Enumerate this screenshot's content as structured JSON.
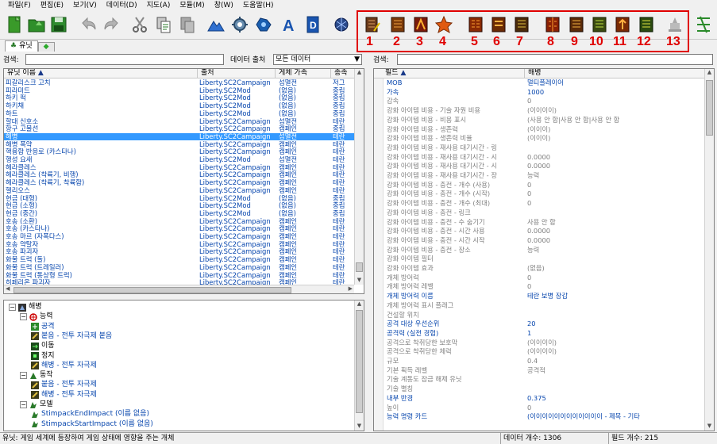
{
  "menu": [
    "파일(F)",
    "편집(E)",
    "보기(V)",
    "데이터(D)",
    "지도(A)",
    "모듈(M)",
    "창(W)",
    "도움말(H)"
  ],
  "toolbar": {
    "numbers": [
      "1",
      "2",
      "3",
      "4",
      "5",
      "6",
      "7",
      "8",
      "9",
      "10",
      "11",
      "12",
      "13"
    ]
  },
  "tabs": [
    "유닛",
    ""
  ],
  "left": {
    "search_label": "검색:",
    "search_value": "",
    "source_label": "데이터 출처",
    "source_value": "모든 데이터",
    "columns": [
      "유닛 이름",
      "출처",
      "게체 가족",
      "종족"
    ],
    "rows": [
      [
        "피갈리스크 고치",
        "Liberty.SC2Campaign",
        "섬멸전",
        "저그"
      ],
      [
        "피라미드",
        "Liberty.SC2Mod",
        "(없음)",
        "중립"
      ],
      [
        "하키 퍽",
        "Liberty.SC2Mod",
        "(없음)",
        "중립"
      ],
      [
        "하키채",
        "Liberty.SC2Mod",
        "(없음)",
        "중립"
      ],
      [
        "하트",
        "Liberty.SC2Mod",
        "(없음)",
        "중립"
      ],
      [
        "할대 신호소",
        "Liberty.SC2Campaign",
        "섬멸전",
        "테란"
      ],
      [
        "항구 고물선",
        "Liberty.SC2Campaign",
        "캠페인",
        "중립"
      ],
      [
        "해병",
        "Liberty.SC2Campaign",
        "섬멸전",
        "테란"
      ],
      [
        "해병 폭약",
        "Liberty.SC2Campaign",
        "캠페인",
        "테란"
      ],
      [
        "핵융합 반응로 (카스타나)",
        "Liberty.SC2Campaign",
        "캠페인",
        "테란"
      ],
      [
        "행성 요새",
        "Liberty.SC2Mod",
        "섬멸전",
        "테란"
      ],
      [
        "헤라클레스",
        "Liberty.SC2Campaign",
        "캠페인",
        "테란"
      ],
      [
        "헤라클레스 (착륙기, 비행)",
        "Liberty.SC2Campaign",
        "캠페인",
        "테란"
      ],
      [
        "헤라클레스 (착륙기, 착륙함)",
        "Liberty.SC2Campaign",
        "캠페인",
        "테란"
      ],
      [
        "헬리오스",
        "Liberty.SC2Campaign",
        "캠페인",
        "테란"
      ],
      [
        "현금 (대형)",
        "Liberty.SC2Mod",
        "(없음)",
        "중립"
      ],
      [
        "현금 (소형)",
        "Liberty.SC2Mod",
        "(없음)",
        "중립"
      ],
      [
        "현금 (중간)",
        "Liberty.SC2Mod",
        "(없음)",
        "중립"
      ],
      [
        "호송 (소환)",
        "Liberty.SC2Campaign",
        "캠페인",
        "테란"
      ],
      [
        "호송 (카스타나)",
        "Liberty.SC2Campaign",
        "캠페인",
        "테란"
      ],
      [
        "호송 마르 (자폭다스)",
        "Liberty.SC2Campaign",
        "캠페인",
        "테란"
      ],
      [
        "호송 약탈자",
        "Liberty.SC2Campaign",
        "캠페인",
        "테란"
      ],
      [
        "호송 파괴자",
        "Liberty.SC2Campaign",
        "캠페인",
        "테란"
      ],
      [
        "화물 트럭 (돌)",
        "Liberty.SC2Campaign",
        "캠페인",
        "테란"
      ],
      [
        "화물 트럭 (트레일러)",
        "Liberty.SC2Campaign",
        "캠페인",
        "테란"
      ],
      [
        "화물 트럭 (통상형 트럭)",
        "Liberty.SC2Campaign",
        "캠페인",
        "테란"
      ],
      [
        "히페리온 파괴자",
        "Liberty.SC2Campaign",
        "캠페인",
        "테란"
      ]
    ],
    "selected_index": 7
  },
  "tree": [
    {
      "indent": 0,
      "label": "해병",
      "icon": "marine-icon",
      "blue": false,
      "expand": "−"
    },
    {
      "indent": 1,
      "label": "능력",
      "icon": "ability-icon",
      "blue": false,
      "expand": "−"
    },
    {
      "indent": 2,
      "label": "공격",
      "icon": "attack-icon",
      "blue": true,
      "expand": ""
    },
    {
      "indent": 2,
      "label": "붙음 - 전투 자극제 붙음",
      "icon": "stim-icon",
      "blue": true,
      "expand": ""
    },
    {
      "indent": 2,
      "label": "이동",
      "icon": "move-icon",
      "blue": false,
      "expand": ""
    },
    {
      "indent": 2,
      "label": "정지",
      "icon": "stop-icon",
      "blue": false,
      "expand": ""
    },
    {
      "indent": 2,
      "label": "해병 - 전투 자극제",
      "icon": "stim-icon",
      "blue": true,
      "expand": ""
    },
    {
      "indent": 1,
      "label": "동작",
      "icon": "behavior-icon",
      "blue": false,
      "expand": "−"
    },
    {
      "indent": 2,
      "label": "붙음 - 전투 자극제",
      "icon": "stim-icon",
      "blue": true,
      "expand": ""
    },
    {
      "indent": 2,
      "label": "해병 - 전투 자극제",
      "icon": "stim-icon",
      "blue": true,
      "expand": ""
    },
    {
      "indent": 1,
      "label": "모델",
      "icon": "model-icon",
      "blue": false,
      "expand": "−"
    },
    {
      "indent": 2,
      "label": "StimpackEndImpact (이름 없음)",
      "icon": "model-icon",
      "blue": true,
      "expand": ""
    },
    {
      "indent": 2,
      "label": "StimpackStartImpact (이름 없음)",
      "icon": "model-icon",
      "blue": true,
      "expand": ""
    }
  ],
  "right": {
    "search_label": "검색:",
    "columns": [
      "필드",
      "해병"
    ],
    "rows": [
      [
        "MOB",
        "멀티플레이어",
        true
      ],
      [
        "가속",
        "1000",
        true
      ],
      [
        "감속",
        "0",
        false
      ],
      [
        "강화 아이템 비용 - 기술 자원 비용",
        "(이이이이)",
        false
      ],
      [
        "강화 아이템 비용 - 비용 표시",
        "(사용 안 함|사용 안 함|사용 안 함",
        false
      ],
      [
        "강화 아이템 비용 - 생존력",
        "(이이이)",
        false
      ],
      [
        "강화 아이템 비용 - 생존력 비율",
        "(이이이)",
        false
      ],
      [
        "강화 아이템 비용 - 재사용 대기시간 - 링",
        "",
        false
      ],
      [
        "강화 아이템 비용 - 재사용 대기시간 - 시",
        "0.0000",
        false
      ],
      [
        "강화 아이템 비용 - 재사용 대기시간 - 시",
        "0.0000",
        false
      ],
      [
        "강화 아이템 비용 - 재사용 대기시간 - 장",
        "능력",
        false
      ],
      [
        "강화 아이템 비용 - 충전 - 개수 (사용)",
        "0",
        false
      ],
      [
        "강화 아이템 비용 - 충전 - 개수 (시작)",
        "0",
        false
      ],
      [
        "강화 아이템 비용 - 충전 - 개수 (최대)",
        "0",
        false
      ],
      [
        "강화 아이템 비용 - 충전 - 링크",
        "",
        false
      ],
      [
        "강화 아이템 비용 - 충전 - 수 숨기기",
        "사용 안 함",
        false
      ],
      [
        "강화 아이템 비용 - 충전 - 시간 사용",
        "0.0000",
        false
      ],
      [
        "강화 아이템 비용 - 충전 - 시간 시작",
        "0.0000",
        false
      ],
      [
        "강화 아이템 비용 - 충전 - 장소",
        "능력",
        false
      ],
      [
        "강화 아이템 필터",
        "",
        false
      ],
      [
        "강화 아이템 효과",
        "(없음)",
        false
      ],
      [
        "개체 방어력",
        "0",
        false
      ],
      [
        "개체 방어력 레벨",
        "0",
        false
      ],
      [
        "개체 방어력 이름",
        "테란 보병 장갑",
        true
      ],
      [
        "개체 방어력 표시 플래그",
        "",
        false
      ],
      [
        "건설할 위치",
        "",
        false
      ],
      [
        "공격 대상 우선순위",
        "20",
        true
      ],
      [
        "공격력 (실전 경험)",
        "1",
        true
      ],
      [
        "공격으로 착취당한 보호막",
        "(이이이이)",
        false
      ],
      [
        "공격으로 착취당한 체력",
        "(이이이이)",
        false
      ],
      [
        "규모",
        "0.4",
        false
      ],
      [
        "기본 획득 레벨",
        "공격적",
        false
      ],
      [
        "기술 계통도 잠금 해제 유닛",
        "",
        false
      ],
      [
        "기술 별칭",
        "",
        false
      ],
      [
        "내부 반경",
        "0.375",
        true
      ],
      [
        "높이",
        "0",
        false
      ],
      [
        "능력 명령 카드",
        "(이이이이이이이이이이이이 - 제목 - 기타",
        true
      ]
    ]
  },
  "status": {
    "left": "유닛: 게임 세계에 등장하여 게임 상태에 영향을 주는 개체",
    "data_count": "데이터 개수: 1306",
    "field_count": "필드 개수: 215"
  }
}
